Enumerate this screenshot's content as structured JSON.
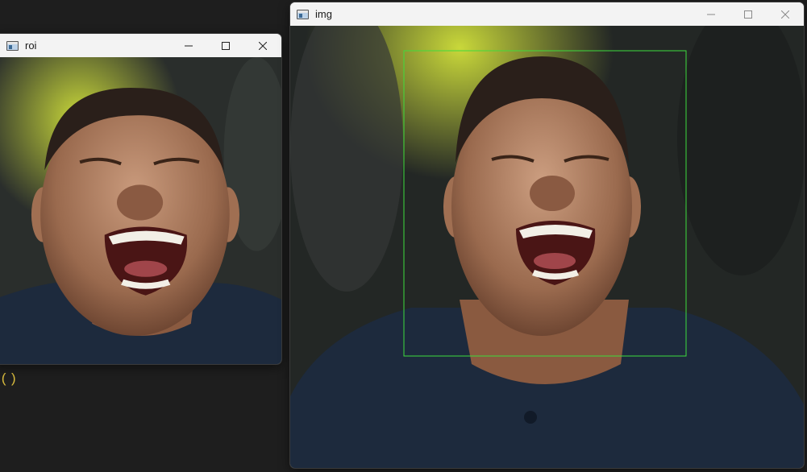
{
  "windows": {
    "roi": {
      "title": "roi"
    },
    "img": {
      "title": "img"
    }
  },
  "terminal": {
    "snippet": "()"
  },
  "colors": {
    "detection_box": "#3ddc3d",
    "code_text": "#d7ba3d",
    "titlebar_bg": "#f3f3f3",
    "desktop_bg": "#1e1e1e"
  },
  "icons": [
    "app-window-icon",
    "minimize-icon",
    "maximize-icon",
    "close-icon"
  ]
}
